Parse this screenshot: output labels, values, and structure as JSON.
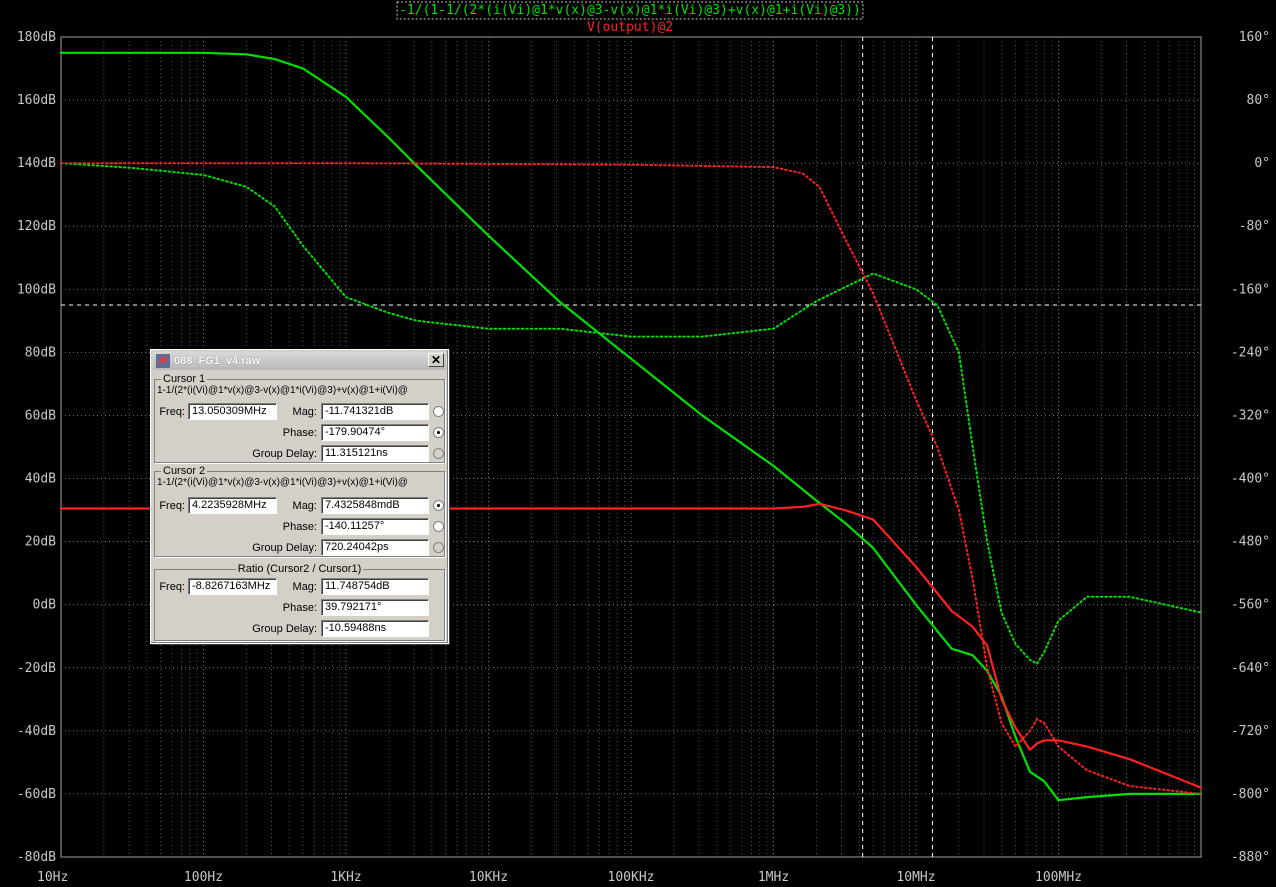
{
  "chart_data": {
    "type": "line",
    "title": "",
    "trace_labels": [
      "-1/(1-1/(2*(i(Vi)@1*v(x)@3-v(x)@1*i(Vi)@3)+v(x)@1+i(Vi)@3))",
      "V(output)@2"
    ],
    "x_scale": "log",
    "xlim": [
      10,
      1000000000
    ],
    "x_tick_labels": [
      "10Hz",
      "100Hz",
      "1KHz",
      "10KHz",
      "100KHz",
      "1MHz",
      "10MHz",
      "100MHz"
    ],
    "y_left_range_dB": [
      -80,
      180
    ],
    "y_left_tick_labels": [
      "180dB",
      "160dB",
      "140dB",
      "120dB",
      "100dB",
      "80dB",
      "60dB",
      "40dB",
      "20dB",
      "0dB",
      "-20dB",
      "-40dB",
      "-60dB",
      "-80dB"
    ],
    "y_right_range_deg": [
      -880,
      160
    ],
    "y_right_tick_labels": [
      "160°",
      "80°",
      "0°",
      "-80°",
      "-160°",
      "-240°",
      "-320°",
      "-400°",
      "-480°",
      "-560°",
      "-640°",
      "-720°",
      "-800°",
      "-880°"
    ],
    "grid": true,
    "cursor_lines": {
      "x_hz": [
        4223593,
        13050309
      ],
      "y_phase_deg": [
        -179.9
      ]
    },
    "series": [
      {
        "name": "-1/(1-1/(2*(i(Vi)@1*v(x)@3-v(x)@1*i(Vi)@3)+v(x)@1+i(Vi)@3))",
        "quantity": "magnitude",
        "axis": "left",
        "color": "#00e000",
        "dashed": false,
        "x": [
          10,
          31.6,
          100,
          200,
          316,
          500,
          1000,
          2000,
          3162,
          10000,
          31623,
          100000,
          316228,
          1000000,
          2000000,
          3162278,
          5000000,
          10000000,
          17800000,
          25000000,
          31600000,
          39800000,
          50000000,
          63100000,
          79400000,
          100000000,
          158500000,
          316200000,
          631000000,
          1000000000
        ],
        "y": [
          175,
          175,
          175,
          174.5,
          173,
          170,
          161,
          148,
          139,
          117,
          96,
          78,
          60,
          44,
          33,
          26,
          18,
          0,
          -14,
          -16,
          -21,
          -29,
          -42,
          -53,
          -56,
          -62,
          -61,
          -60,
          -60,
          -60
        ]
      },
      {
        "name": "-1/(1-1/(2*(i(Vi)@1*v(x)@3-v(x)@1*i(Vi)@3)+v(x)@1+i(Vi)@3))",
        "quantity": "phase",
        "axis": "right",
        "color": "#00e000",
        "dashed": true,
        "x": [
          10,
          31.6,
          100,
          200,
          316,
          500,
          1000,
          2000,
          3162,
          10000,
          31623,
          100000,
          316228,
          1000000,
          2000000,
          5000000,
          10000000,
          14100000,
          20000000,
          25000000,
          31600000,
          39800000,
          50000000,
          63100000,
          70800000,
          79400000,
          100000000,
          158500000,
          316200000,
          1000000000
        ],
        "y": [
          0,
          -6,
          -15,
          -30,
          -55,
          -105,
          -170,
          -190,
          -200,
          -210,
          -210,
          -220,
          -220,
          -210,
          -175,
          -140,
          -160,
          -180,
          -240,
          -360,
          -480,
          -570,
          -610,
          -630,
          -635,
          -620,
          -580,
          -550,
          -550,
          -570
        ]
      },
      {
        "name": "V(output)@2",
        "quantity": "magnitude",
        "axis": "left",
        "color": "#ff2020",
        "dashed": false,
        "x": [
          10,
          100,
          1000,
          10000,
          100000,
          1000000,
          1600000,
          2100000,
          3162278,
          5000000,
          10000000,
          17800000,
          25000000,
          31600000,
          39800000,
          50000000,
          63100000,
          70800000,
          79400000,
          100000000,
          158500000,
          316200000,
          1000000000
        ],
        "y": [
          30.5,
          30.5,
          30.5,
          30.5,
          30.5,
          30.5,
          31,
          32,
          30,
          27,
          12,
          -2,
          -7,
          -13,
          -30,
          -39,
          -46,
          -44,
          -43,
          -43,
          -45,
          -49,
          -58
        ]
      },
      {
        "name": "V(output)@2",
        "quantity": "phase",
        "axis": "right",
        "color": "#ff2020",
        "dashed": true,
        "x": [
          10,
          100,
          1000,
          10000,
          100000,
          1000000,
          1600000,
          2100000,
          3162278,
          5000000,
          6300000,
          10000000,
          14100000,
          20000000,
          25100000,
          31600000,
          39800000,
          50000000,
          63100000,
          70800000,
          79400000,
          100000000,
          158500000,
          316200000,
          1000000000
        ],
        "y": [
          0,
          0,
          0,
          -1,
          -2,
          -5,
          -13,
          -30,
          -95,
          -165,
          -210,
          -300,
          -360,
          -440,
          -530,
          -640,
          -710,
          -740,
          -720,
          -705,
          -710,
          -740,
          -770,
          -790,
          -800
        ]
      }
    ]
  },
  "dialog": {
    "title": "088_FG1_v4.raw",
    "cursor1": {
      "legend": "Cursor 1",
      "expr": "1-1/(2*(i(Vi)@1*v(x)@3-v(x)@1*i(Vi)@3)+v(x)@1+i(Vi)@",
      "freq_label": "Freq:",
      "freq": "13.050309MHz",
      "mag_label": "Mag:",
      "mag": "-11.741321dB",
      "phase_label": "Phase:",
      "phase": "-179.90474°",
      "gd_label": "Group Delay:",
      "gd": "11.315121ns"
    },
    "cursor2": {
      "legend": "Cursor 2",
      "expr": "1-1/(2*(i(Vi)@1*v(x)@3-v(x)@1*i(Vi)@3)+v(x)@1+i(Vi)@",
      "freq_label": "Freq:",
      "freq": "4.2235928MHz",
      "mag_label": "Mag:",
      "mag": "7.4325848mdB",
      "phase_label": "Phase:",
      "phase": "-140.11257°",
      "gd_label": "Group Delay:",
      "gd": "720.24042ps"
    },
    "ratio": {
      "legend": "Ratio (Cursor2 / Cursor1)",
      "freq_label": "Freq:",
      "freq": "-8.8267163MHz",
      "mag_label": "Mag:",
      "mag": "11.748754dB",
      "phase_label": "Phase:",
      "phase": "39.792171°",
      "gd_label": "Group Delay:",
      "gd": "-10.59488ns"
    },
    "close_glyph": "✕"
  }
}
